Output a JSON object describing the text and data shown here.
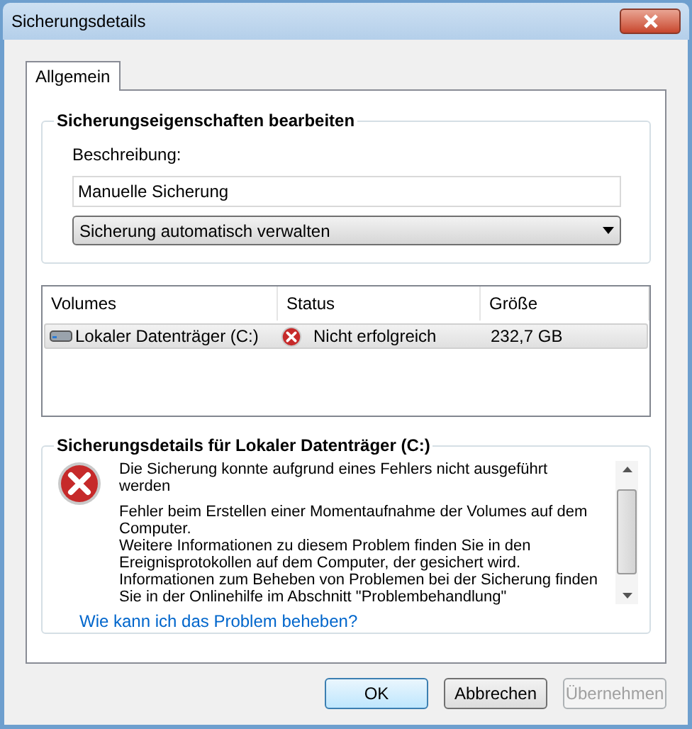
{
  "window": {
    "title": "Sicherungsdetails"
  },
  "tabs": [
    {
      "label": "Allgemein",
      "selected": true
    }
  ],
  "properties": {
    "title": "Sicherungseigenschaften bearbeiten",
    "description_label": "Beschreibung:",
    "description_value": "Manuelle Sicherung",
    "dropdown_value": "Sicherung automatisch verwalten"
  },
  "table": {
    "columns": [
      "Volumes",
      "Status",
      "Größe"
    ],
    "rows": [
      {
        "volume": "Lokaler Datenträger (C:)",
        "status": "Nicht erfolgreich",
        "kind": "error",
        "size": "232,7 GB",
        "selected": true
      }
    ]
  },
  "details": {
    "title": "Sicherungsdetails für Lokaler Datenträger (C:)",
    "message_title": "Die Sicherung konnte aufgrund eines Fehlers nicht ausgeführt werden",
    "paragraphs": [
      "Fehler beim Erstellen einer Momentaufnahme der Volumes auf dem Computer.",
      "Weitere Informationen zu diesem Problem finden Sie in den Ereignisprotokollen auf dem Computer, der gesichert wird.",
      "Informationen zum Beheben von Problemen bei der Sicherung finden Sie in der Onlinehilfe im Abschnitt \"Problembehandlung\""
    ],
    "link": "Wie kann ich das Problem beheben?"
  },
  "buttons": [
    {
      "label": "OK",
      "default": true,
      "disabled": false
    },
    {
      "label": "Abbrechen",
      "default": false,
      "disabled": false
    },
    {
      "label": "Übernehmen",
      "default": false,
      "disabled": true
    }
  ]
}
